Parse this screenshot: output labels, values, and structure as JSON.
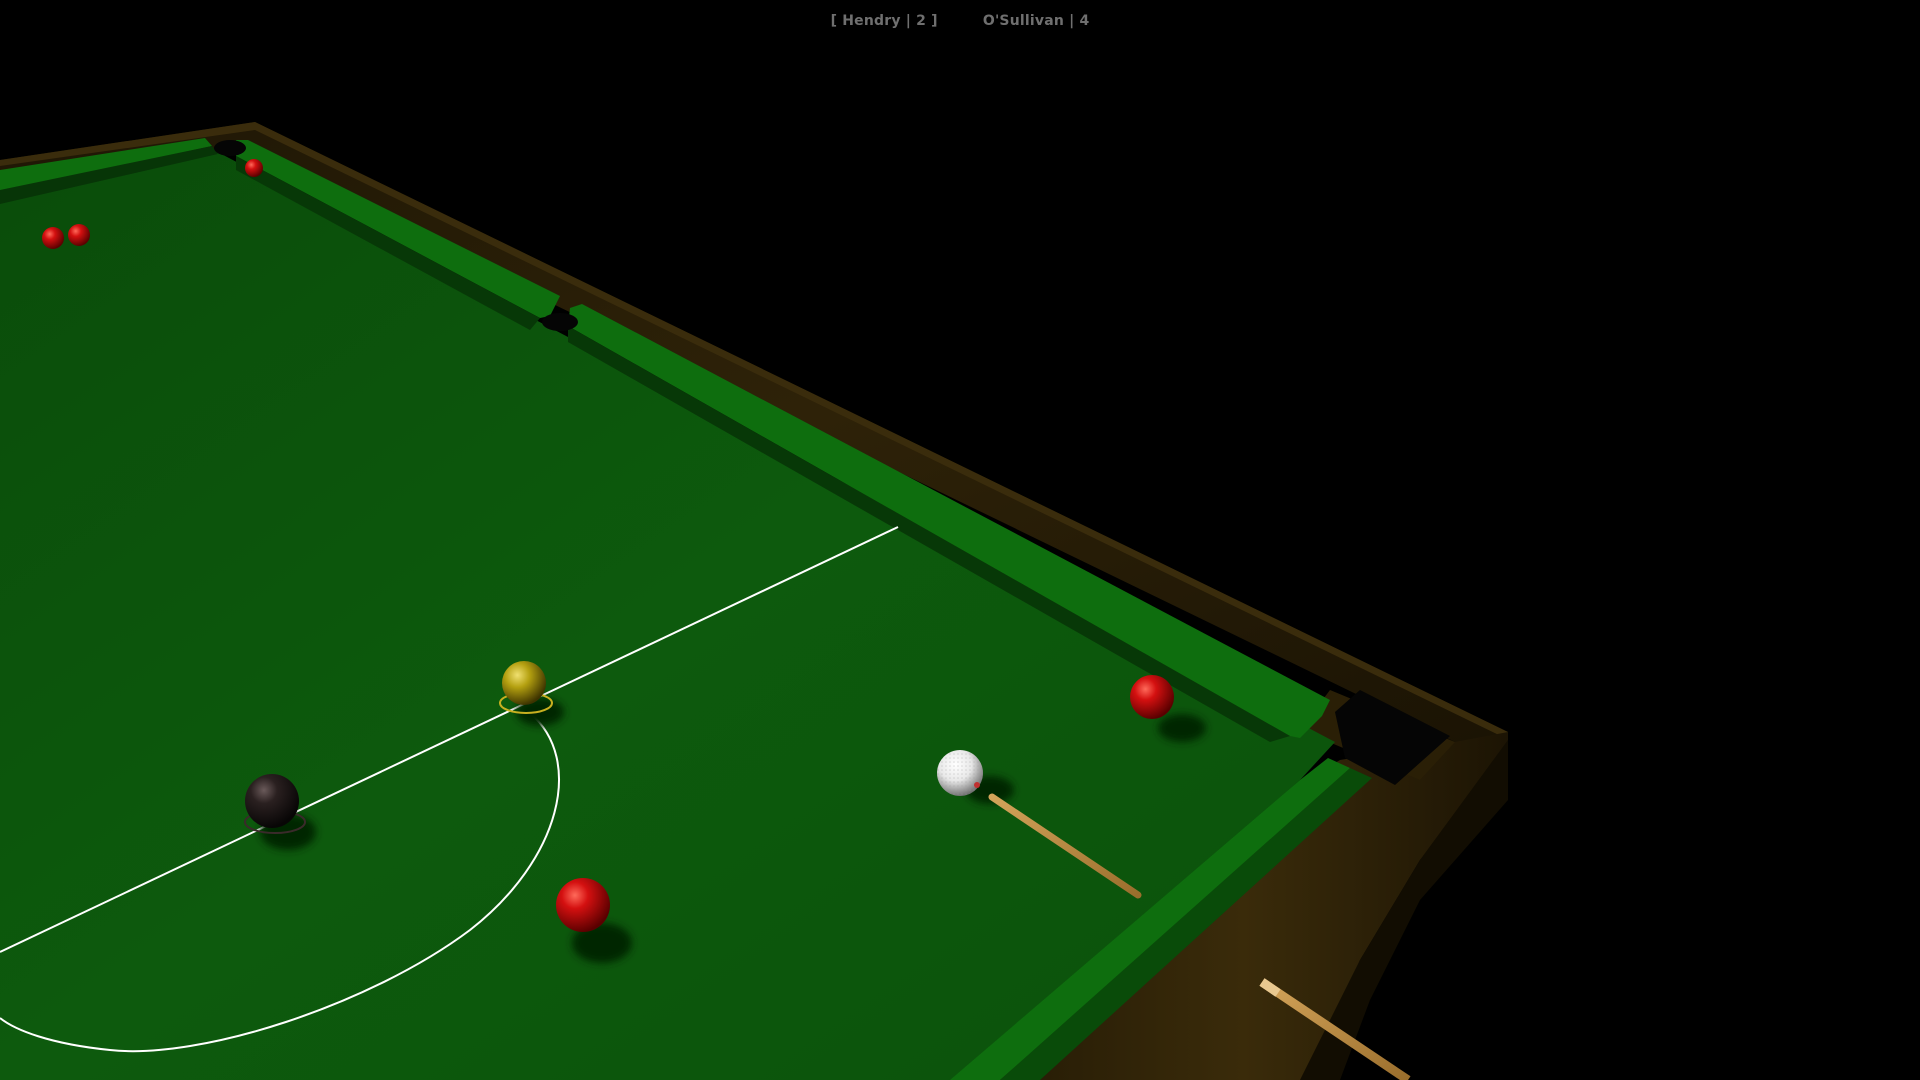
{
  "scoreboard": {
    "player1": "[ Hendry | 2 ]",
    "player2": "O'Sullivan | 4"
  },
  "colors": {
    "background": "#000000",
    "cloth": "#0d5a0d",
    "cushion": "#0c6a0c",
    "wood": "#2e2208",
    "line": "#ffffff",
    "red_ball": "#c30808",
    "yellow_ball": "#b8a410",
    "black_ball": "#221818",
    "cue_ball": "#f2f2f2",
    "cue": "#b98a40"
  },
  "balls": [
    "red",
    "red",
    "red",
    "red",
    "red",
    "yellow",
    "black",
    "cue-ball"
  ]
}
